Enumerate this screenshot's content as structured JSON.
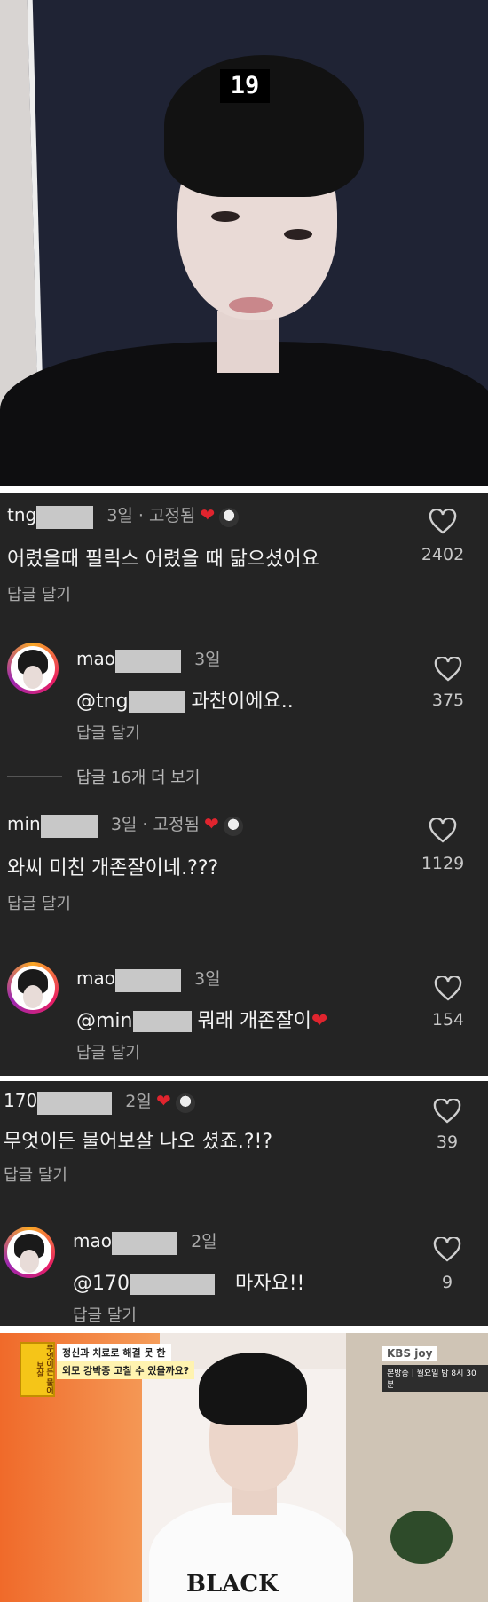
{
  "photo_top": {
    "badge": "19"
  },
  "comments": [
    {
      "user": "tng",
      "meta": "3일 · 고정됨",
      "text": "어렸을때 필릭스 어렸을 때 닮으셨어요",
      "reply": "답글 달기",
      "likes": "2402",
      "replies": [
        {
          "user": "mao",
          "meta": "3일",
          "mention": "@tng",
          "text": "과찬이에요..",
          "reply": "답글 달기",
          "likes": "375"
        }
      ],
      "more": "답글 16개 더 보기"
    },
    {
      "user": "min",
      "meta": "3일 · 고정됨",
      "text": "와씨 미친 개존잘이네.???",
      "reply": "답글 달기",
      "likes": "1129",
      "replies": [
        {
          "user": "mao",
          "meta": "3일",
          "mention": "@min",
          "text": "뭐래 개존잘이",
          "reply": "답글 달기",
          "likes": "154"
        }
      ]
    },
    {
      "user": "170",
      "meta": "2일",
      "text": "무엇이든 물어보살 나오 셨죠.?!?",
      "reply": "답글 달기",
      "likes": "39",
      "replies": [
        {
          "user": "mao",
          "meta": "2일",
          "mention": "@170",
          "text": "마자요!!",
          "reply": "답글 달기",
          "likes": "9"
        }
      ]
    }
  ],
  "photo_bottom": {
    "show_badge": "무엇이든 물어보살",
    "caption_line1": "정신과 치료로 해결 못 한",
    "caption_line2": "외모 강박증 고칠 수 있을까요?",
    "channel": "KBS joy",
    "schedule": "본방송 | 월요일 밤 8시 30분",
    "shirt_text": "BLACK"
  },
  "colors": {
    "panel_bg": "#242424",
    "heart_red": "#e0242e",
    "text": "#f2f2f2",
    "muted": "#a8a8a8"
  }
}
